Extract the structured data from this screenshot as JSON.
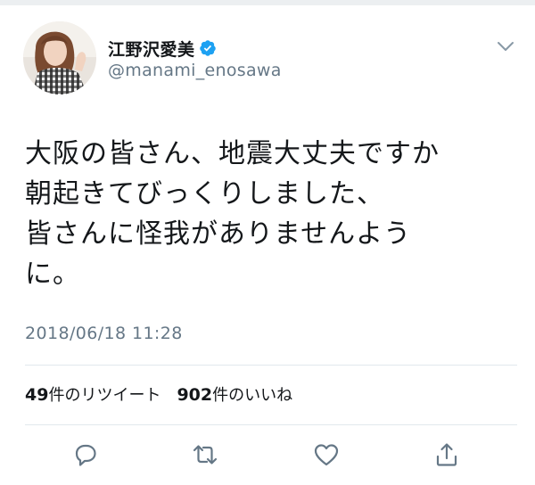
{
  "user": {
    "display_name": "江野沢愛美",
    "handle": "@manami_enosawa",
    "verified": true
  },
  "tweet": {
    "lines": [
      "大阪の皆さん、地震大丈夫ですか",
      "朝起きてびっくりしました、",
      "皆さんに怪我がありませんよう",
      "に。"
    ],
    "timestamp": "2018/06/18 11:28"
  },
  "stats": {
    "retweets_count": "49",
    "retweets_label": "件のリツイート",
    "likes_count": "902",
    "likes_label": "件のいいね"
  },
  "icons": {
    "verified": "verified-badge-icon",
    "caret": "chevron-down-icon",
    "reply": "reply-icon",
    "retweet": "retweet-icon",
    "like": "heart-icon",
    "share": "share-icon"
  },
  "colors": {
    "text": "#14171a",
    "secondary": "#657786",
    "verified": "#1da1f2",
    "divider": "#e1e8ed",
    "action_icon": "#657786"
  }
}
